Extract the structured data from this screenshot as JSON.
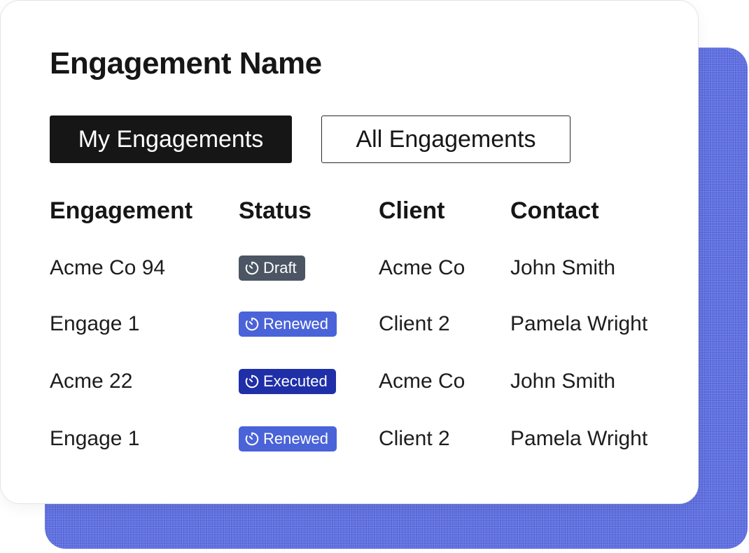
{
  "card": {
    "title": "Engagement Name"
  },
  "tabs": [
    {
      "label": "My Engagements",
      "active": true
    },
    {
      "label": "All Engagements",
      "active": false
    }
  ],
  "table": {
    "headers": [
      "Engagement",
      "Status",
      "Client",
      "Contact"
    ],
    "rows": [
      {
        "engagement": "Acme Co 94",
        "status": "Draft",
        "client": "Acme Co",
        "contact": "John Smith"
      },
      {
        "engagement": "Engage 1",
        "status": "Renewed",
        "client": "Client 2",
        "contact": "Pamela Wright"
      },
      {
        "engagement": "Acme 22",
        "status": "Executed",
        "client": "Acme Co",
        "contact": "John Smith"
      },
      {
        "engagement": "Engage 1",
        "status": "Renewed",
        "client": "Client 2",
        "contact": "Pamela Wright"
      }
    ]
  },
  "status_icon": "timer-icon",
  "colors": {
    "backdrop": "#5a6be0",
    "tab_active_bg": "#161616",
    "draft": "#4b5563",
    "renewed": "#4a63d8",
    "executed": "#1f2fa8"
  }
}
